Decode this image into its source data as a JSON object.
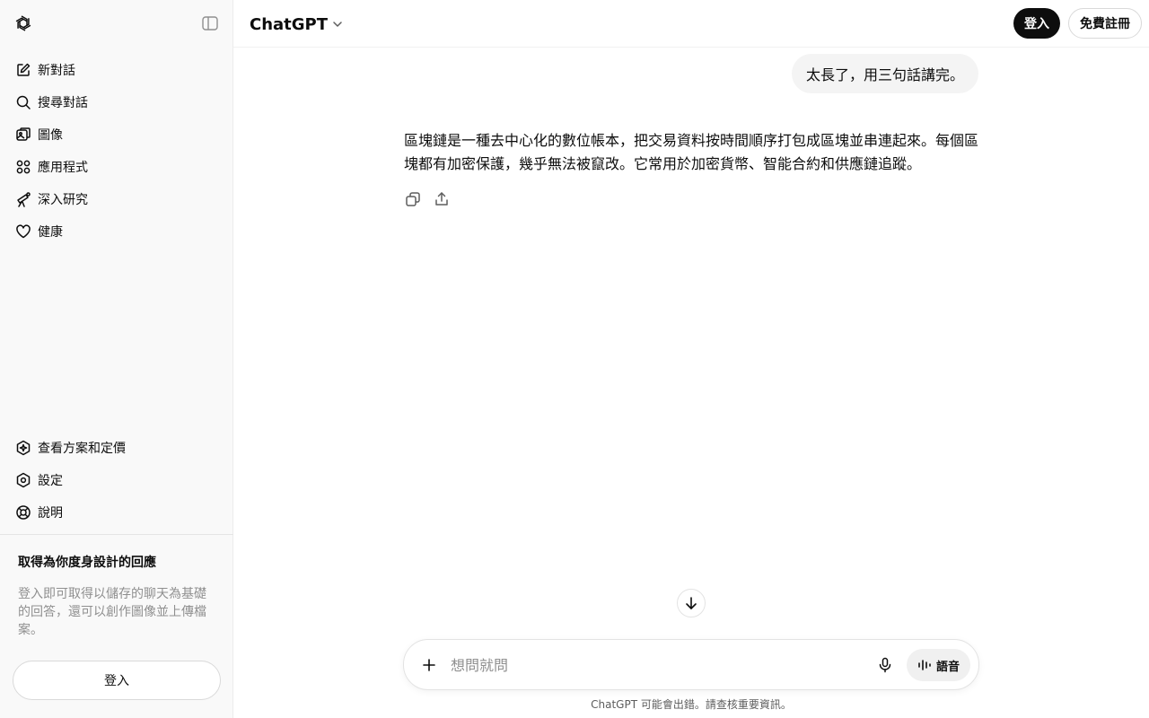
{
  "sidebar": {
    "nav": [
      {
        "label": "新對話",
        "icon": "edit-icon"
      },
      {
        "label": "搜尋對話",
        "icon": "search-icon"
      },
      {
        "label": "圖像",
        "icon": "image-icon"
      },
      {
        "label": "應用程式",
        "icon": "apps-icon"
      },
      {
        "label": "深入研究",
        "icon": "telescope-icon"
      },
      {
        "label": "健康",
        "icon": "heart-icon"
      }
    ],
    "bottom": [
      {
        "label": "查看方案和定價",
        "icon": "upgrade-icon"
      },
      {
        "label": "設定",
        "icon": "gear-icon"
      },
      {
        "label": "說明",
        "icon": "help-icon"
      }
    ],
    "promo": {
      "title": "取得為你度身設計的回應",
      "text": "登入即可取得以儲存的聊天為基礎的回答，還可以創作圖像並上傳檔案。"
    },
    "login_label": "登入"
  },
  "header": {
    "model": "ChatGPT",
    "login_label": "登入",
    "signup_label": "免費註冊"
  },
  "conversation": {
    "user_message": "太長了，用三句話講完。",
    "assistant_message": "區塊鏈是一種去中心化的數位帳本，把交易資料按時間順序打包成區塊並串連起來。每個區塊都有加密保護，幾乎無法被竄改。它常用於加密貨幣、智能合約和供應鏈追蹤。"
  },
  "composer": {
    "placeholder": "想問就問",
    "voice_label": "語音"
  },
  "disclaimer": "ChatGPT 可能會出錯。請查核重要資訊。",
  "colors": {
    "sidebar_bg": "#f9f9f9",
    "primary_button": "#0d0d0d",
    "bubble_bg": "#f4f4f4"
  }
}
